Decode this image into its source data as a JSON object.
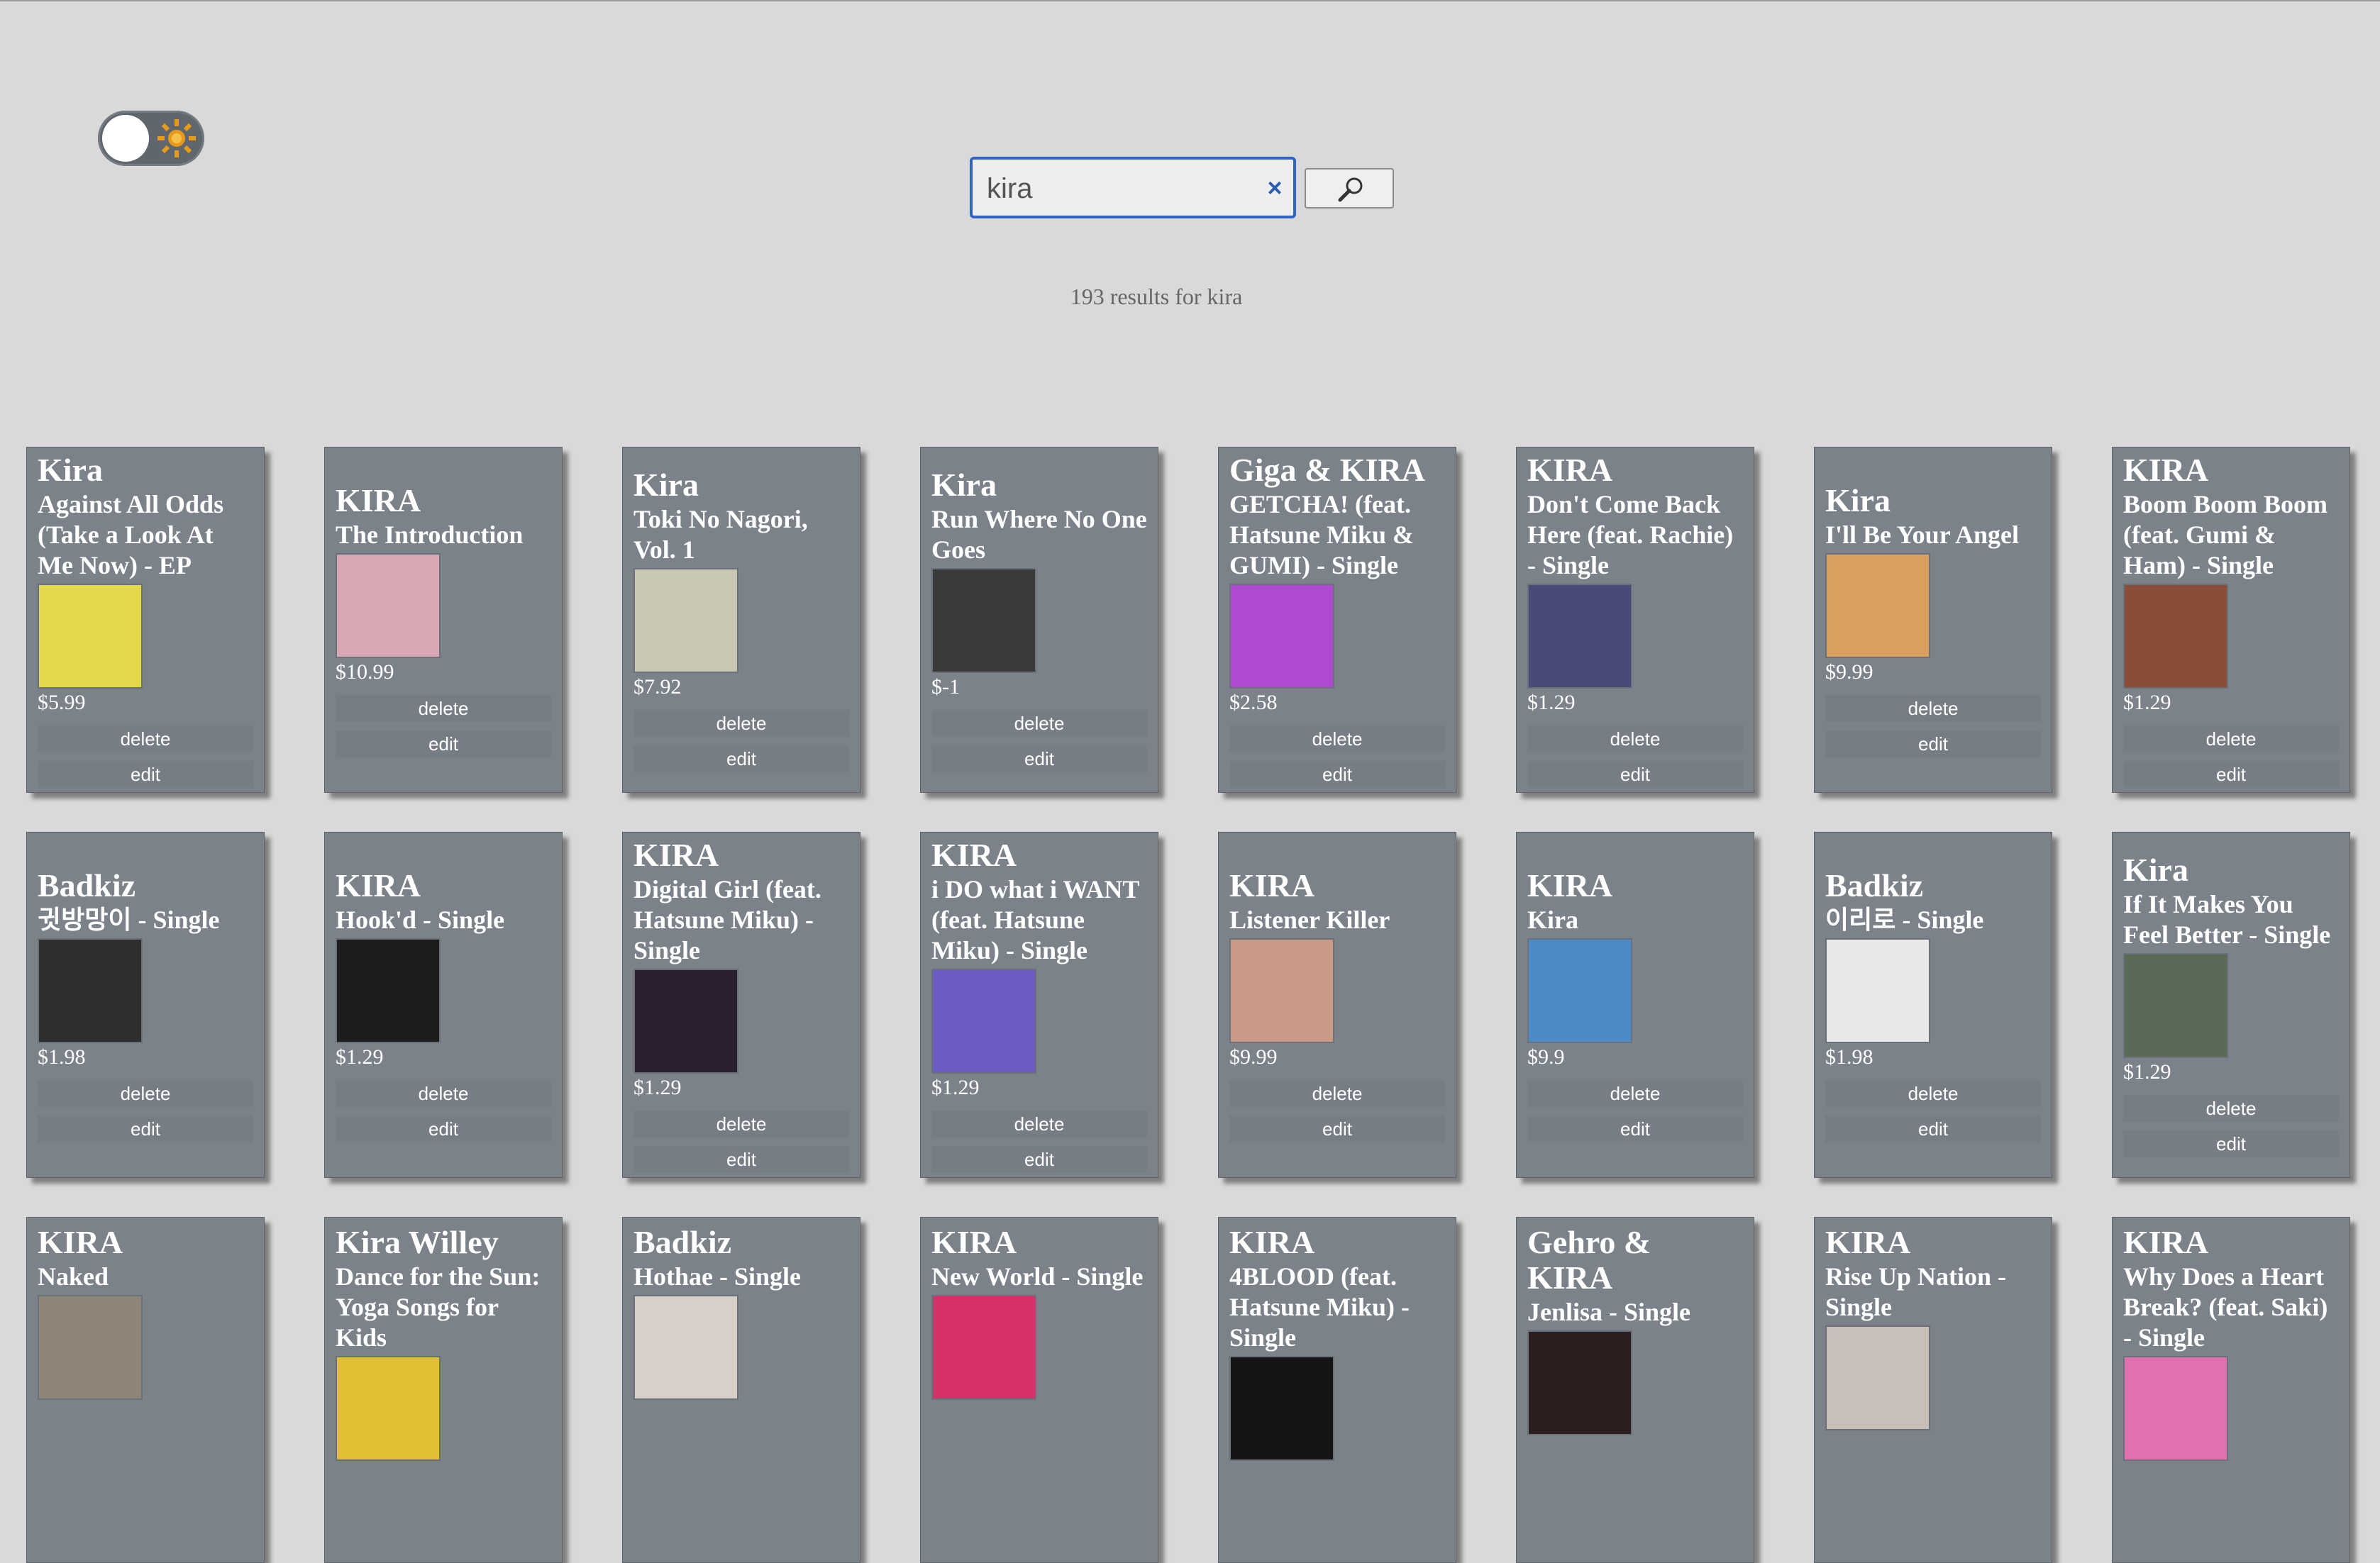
{
  "theme_toggle": {
    "icon": "sun-icon",
    "state": "light"
  },
  "search": {
    "value": "kira",
    "clear_label": "×",
    "button_icon": "magnifier-icon"
  },
  "result_summary": "193 results for kira",
  "colors": {
    "background": "#d9d9d9",
    "card": "#7b828a",
    "accent": "#2f63c4"
  },
  "cards": [
    {
      "artist": "Kira",
      "title": "Against All Odds (Take a Look At Me Now) - EP",
      "price": "$5.99",
      "delete": "delete",
      "edit": "edit",
      "art": "#e4d84a"
    },
    {
      "artist": "KIRA",
      "title": "The Introduction",
      "price": "$10.99",
      "delete": "delete",
      "edit": "edit",
      "art": "#d9a7b3"
    },
    {
      "artist": "Kira",
      "title": "Toki No Nagori, Vol. 1",
      "price": "$7.92",
      "delete": "delete",
      "edit": "edit",
      "art": "#c9c6b2"
    },
    {
      "artist": "Kira",
      "title": "Run Where No One Goes",
      "price": "$-1",
      "delete": "delete",
      "edit": "edit",
      "art": "#3a3a3a"
    },
    {
      "artist": "Giga & KIRA",
      "title": "GETCHA! (feat. Hatsune Miku & GUMI) - Single",
      "price": "$2.58",
      "delete": "delete",
      "edit": "edit",
      "art": "#b04ad0"
    },
    {
      "artist": "KIRA",
      "title": "Don't Come Back Here (feat. Rachie) - Single",
      "price": "$1.29",
      "delete": "delete",
      "edit": "edit",
      "art": "#4a4a78"
    },
    {
      "artist": "Kira",
      "title": "I'll Be Your Angel",
      "price": "$9.99",
      "delete": "delete",
      "edit": "edit",
      "art": "#d9a060"
    },
    {
      "artist": "KIRA",
      "title": "Boom Boom Boom (feat. Gumi & Ham) - Single",
      "price": "$1.29",
      "delete": "delete",
      "edit": "edit",
      "art": "#8a4e38"
    },
    {
      "artist": "Badkiz",
      "title": "귓방망이 - Single",
      "price": "$1.98",
      "delete": "delete",
      "edit": "edit",
      "art": "#2e2e2e"
    },
    {
      "artist": "KIRA",
      "title": "Hook'd - Single",
      "price": "$1.29",
      "delete": "delete",
      "edit": "edit",
      "art": "#1c1c1c"
    },
    {
      "artist": "KIRA",
      "title": "Digital Girl (feat. Hatsune Miku) - Single",
      "price": "$1.29",
      "delete": "delete",
      "edit": "edit",
      "art": "#2a2030"
    },
    {
      "artist": "KIRA",
      "title": "i DO what i WANT (feat. Hatsune Miku) - Single",
      "price": "$1.29",
      "delete": "delete",
      "edit": "edit",
      "art": "#6a5cc0"
    },
    {
      "artist": "KIRA",
      "title": "Listener Killer",
      "price": "$9.99",
      "delete": "delete",
      "edit": "edit",
      "art": "#c99a86"
    },
    {
      "artist": "KIRA",
      "title": "Kira",
      "price": "$9.9",
      "delete": "delete",
      "edit": "edit",
      "art": "#4d8ac8"
    },
    {
      "artist": "Badkiz",
      "title": "이리로 - Single",
      "price": "$1.98",
      "delete": "delete",
      "edit": "edit",
      "art": "#e8e8e8"
    },
    {
      "artist": "Kira",
      "title": "If It Makes You Feel Better - Single",
      "price": "$1.29",
      "delete": "delete",
      "edit": "edit",
      "art": "#5a6a58"
    },
    {
      "artist": "KIRA",
      "title": "Naked",
      "price": "",
      "delete": "",
      "edit": "",
      "art": "#8e8478"
    },
    {
      "artist": "Kira Willey",
      "title": "Dance for the Sun: Yoga Songs for Kids",
      "price": "",
      "delete": "",
      "edit": "",
      "art": "#e0c030"
    },
    {
      "artist": "Badkiz",
      "title": "Hothae - Single",
      "price": "",
      "delete": "",
      "edit": "",
      "art": "#d8d0c8"
    },
    {
      "artist": "KIRA",
      "title": "New World - Single",
      "price": "",
      "delete": "",
      "edit": "",
      "art": "#d8306a"
    },
    {
      "artist": "KIRA",
      "title": "4BLOOD (feat. Hatsune Miku) - Single",
      "price": "",
      "delete": "",
      "edit": "",
      "art": "#151515"
    },
    {
      "artist": "Gehro & KIRA",
      "title": "Jenlisa - Single",
      "price": "",
      "delete": "",
      "edit": "",
      "art": "#2a1e1e"
    },
    {
      "artist": "KIRA",
      "title": "Rise Up Nation - Single",
      "price": "",
      "delete": "",
      "edit": "",
      "art": "#c8c0b8"
    },
    {
      "artist": "KIRA",
      "title": "Why Does a Heart Break? (feat. Saki) - Single",
      "price": "",
      "delete": "",
      "edit": "",
      "art": "#e070b0"
    }
  ]
}
